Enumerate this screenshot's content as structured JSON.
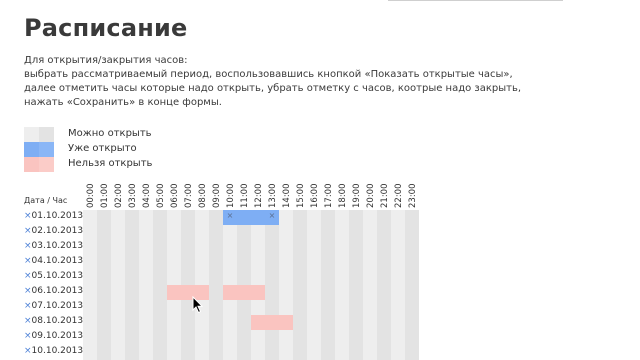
{
  "page": {
    "title": "Расписание",
    "instructions": [
      "Для открытия/закрытия часов:",
      "выбрать рассматриваемый период, воспользовавшись кнопкой «Показать открытые часы»,",
      "далее отметить часы которые надо открыть, убрать отметку с часов, коотрые надо закрыть,",
      "нажать «Сохранить» в конце формы."
    ]
  },
  "legend": [
    {
      "label": "Можно открыть",
      "color_a": "#eeeeee",
      "color_b": "#e3e3e3"
    },
    {
      "label": "Уже открыто",
      "color_a": "#7eaef4",
      "color_b": "#8ab6f6"
    },
    {
      "label": "Нельзя открыть",
      "color_a": "#fac4c0",
      "color_b": "#fbccc8"
    }
  ],
  "schedule": {
    "corner_label": "Дата / Час",
    "remove_glyph": "×",
    "hours": [
      "00:00",
      "01:00",
      "02:00",
      "03:00",
      "04:00",
      "05:00",
      "06:00",
      "07:00",
      "08:00",
      "09:00",
      "10:00",
      "11:00",
      "12:00",
      "13:00",
      "14:00",
      "15:00",
      "16:00",
      "17:00",
      "18:00",
      "19:00",
      "20:00",
      "21:00",
      "22:00",
      "23:00"
    ],
    "rows": [
      {
        "date": "01.10.2013",
        "open": [
          10,
          11,
          12,
          13
        ],
        "closed": [],
        "marked": [
          10,
          13
        ]
      },
      {
        "date": "02.10.2013",
        "open": [],
        "closed": [],
        "marked": []
      },
      {
        "date": "03.10.2013",
        "open": [],
        "closed": [],
        "marked": []
      },
      {
        "date": "04.10.2013",
        "open": [],
        "closed": [],
        "marked": []
      },
      {
        "date": "05.10.2013",
        "open": [],
        "closed": [],
        "marked": []
      },
      {
        "date": "06.10.2013",
        "open": [],
        "closed": [
          6,
          7,
          8,
          10,
          11,
          12
        ],
        "marked": []
      },
      {
        "date": "07.10.2013",
        "open": [],
        "closed": [],
        "marked": []
      },
      {
        "date": "08.10.2013",
        "open": [],
        "closed": [
          12,
          13,
          14
        ],
        "marked": []
      },
      {
        "date": "09.10.2013",
        "open": [],
        "closed": [],
        "marked": []
      },
      {
        "date": "10.10.2013",
        "open": [],
        "closed": [],
        "marked": []
      }
    ]
  },
  "icons": {
    "cursor": "mouse-pointer-icon"
  }
}
